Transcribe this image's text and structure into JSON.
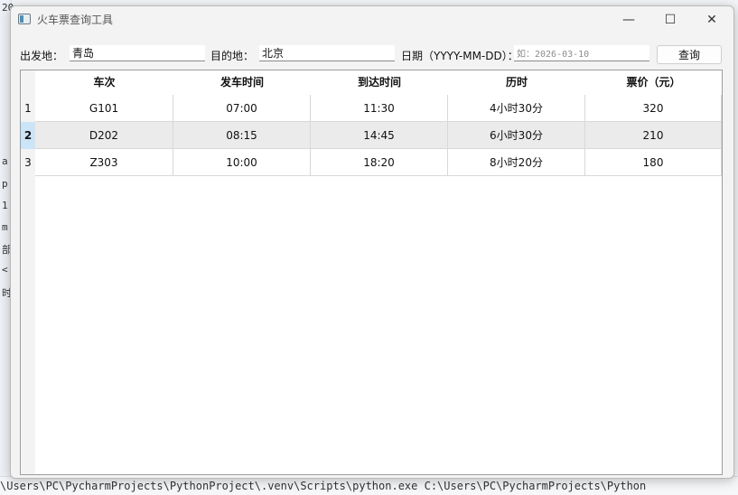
{
  "window": {
    "title": "火车票查询工具",
    "controls": {
      "minimize": "—",
      "maximize": "☐",
      "close": "✕"
    }
  },
  "form": {
    "from_label": "出发地：",
    "from_value": "青岛",
    "to_label": "目的地：",
    "to_value": "北京",
    "date_label": "日期（YYYY-MM-DD）：",
    "date_value": "",
    "date_placeholder": "如：2026-03-10",
    "query_button": "查询"
  },
  "table": {
    "headers": [
      "车次",
      "发车时间",
      "到达时间",
      "历时",
      "票价（元）"
    ],
    "rows": [
      {
        "num": "1",
        "cells": [
          "G101",
          "07:00",
          "11:30",
          "4小时30分",
          "320"
        ]
      },
      {
        "num": "2",
        "cells": [
          "D202",
          "08:15",
          "14:45",
          "6小时30分",
          "210"
        ]
      },
      {
        "num": "3",
        "cells": [
          "Z303",
          "10:00",
          "18:20",
          "8小时20分",
          "180"
        ]
      }
    ],
    "selected_row": "2"
  },
  "background": {
    "left_glyphs": [
      "20",
      "a",
      "p",
      "1",
      "m",
      "部",
      "<",
      "时"
    ],
    "bottom_text": "\\Users\\PC\\PycharmProjects\\PythonProject\\.venv\\Scripts\\python.exe C:\\Users\\PC\\PycharmProjects\\Python"
  }
}
